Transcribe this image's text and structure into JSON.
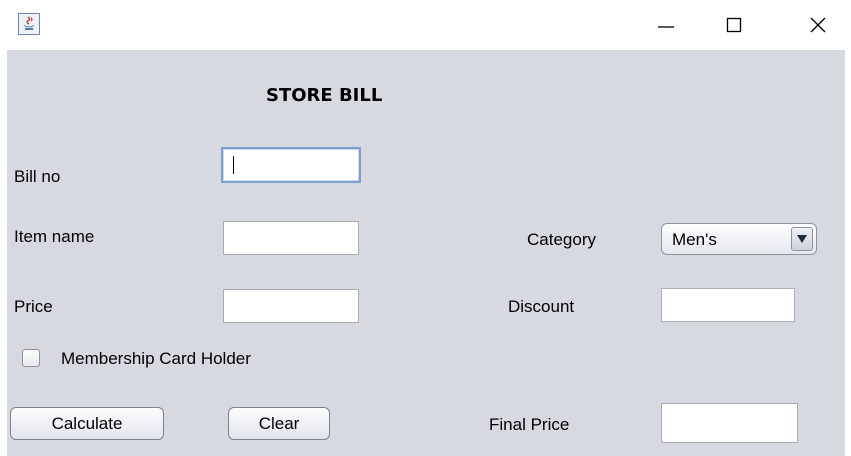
{
  "window": {
    "icon": "java-cup-icon",
    "controls": {
      "minimize": "—",
      "maximize": "☐",
      "close": "✕"
    }
  },
  "form": {
    "heading": "STORE BILL",
    "bill_no": {
      "label": "Bill no",
      "value": ""
    },
    "item_name": {
      "label": "Item name",
      "value": ""
    },
    "price": {
      "label": "Price",
      "value": ""
    },
    "category": {
      "label": "Category",
      "selected": "Men's"
    },
    "discount": {
      "label": "Discount",
      "value": ""
    },
    "membership": {
      "label": "Membership Card Holder",
      "checked": false
    },
    "final_price": {
      "label": "Final Price",
      "value": ""
    },
    "calculate_label": "Calculate",
    "clear_label": "Clear"
  },
  "colors": {
    "panel_bg": "#d6d9e0",
    "focus_border": "#7f9fcd"
  }
}
